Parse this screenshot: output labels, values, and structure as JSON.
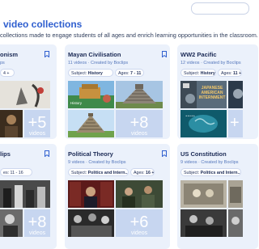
{
  "page": {
    "heading": "video collections",
    "subheading": "collections made to engage students of all ages and enrich learning opportunities in the classroom."
  },
  "cards": [
    {
      "title": "onism",
      "meta": "ps",
      "tags": [
        {
          "label": "",
          "value": "4 +"
        }
      ],
      "more": "+5",
      "more_label": "videos"
    },
    {
      "title": "Mayan Civilisation",
      "meta": "11 videos · Created by Boclips",
      "tags": [
        {
          "label": "Subject:",
          "value": "History"
        },
        {
          "label": "Ages:",
          "value": "7 - 11"
        }
      ],
      "thumb_caption": "History",
      "more": "+8",
      "more_label": "videos"
    },
    {
      "title": "WW2 Pacific",
      "meta": "12 videos · Created by Boclips",
      "tags": [
        {
          "label": "Subject:",
          "value": "History"
        },
        {
          "label": "Ages:",
          "value": "11 +"
        }
      ],
      "thumb_overlay": "JAPANESE AMERICAN INTERNMENT",
      "more": "+",
      "more_label": ""
    },
    {
      "title": "lips",
      "meta": "",
      "tags": [
        {
          "label": "",
          "value": "es: 11 - 16"
        }
      ],
      "more": "+8",
      "more_label": "videos"
    },
    {
      "title": "Political Theory",
      "meta": "9 videos · Created by Boclips",
      "tags": [
        {
          "label": "Subject:",
          "value": "Politics and Intern..."
        },
        {
          "label": "Ages:",
          "value": "16 +"
        }
      ],
      "more": "+6",
      "more_label": "videos"
    },
    {
      "title": "US Constitution",
      "meta": "9 videos · Created by Boclips",
      "tags": [
        {
          "label": "Subject:",
          "value": "Politics and Intern..."
        }
      ],
      "more": "",
      "more_label": ""
    }
  ],
  "colors": {
    "heading": "#2f5fcf",
    "card_bg": "#ebf1fb",
    "more_tile": "#c7d6f0",
    "meta": "#5577bb"
  },
  "icons": {
    "bookmark": "bookmark-icon",
    "search": "search-box"
  }
}
